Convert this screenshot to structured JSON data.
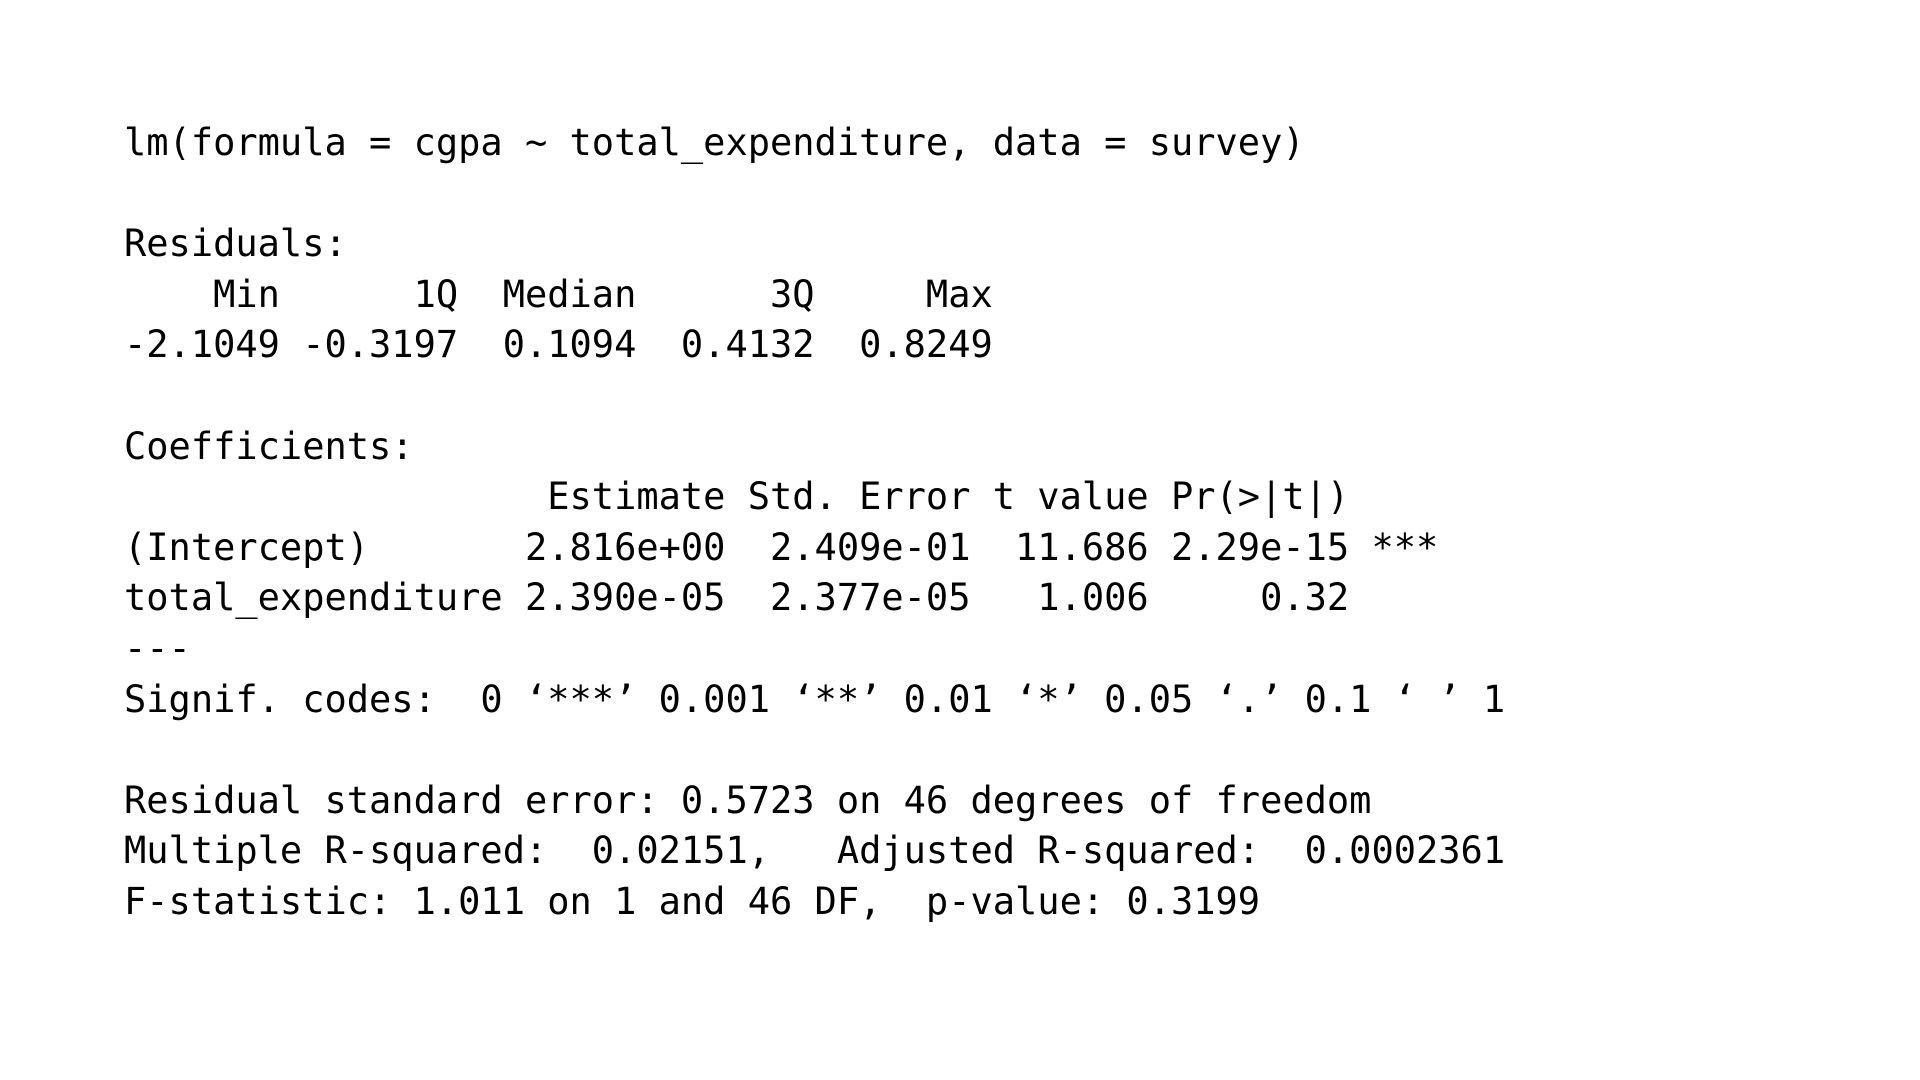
{
  "call": "lm(formula = cgpa ~ total_expenditure, data = survey)",
  "residuals": {
    "heading": "Residuals:",
    "header_line": "    Min      1Q  Median      3Q     Max ",
    "values_line": "-2.1049 -0.3197  0.1094  0.4132  0.8249 "
  },
  "coefficients": {
    "heading": "Coefficients:",
    "header_line": "                   Estimate Std. Error t value Pr(>|t|)    ",
    "rows": [
      "(Intercept)       2.816e+00  2.409e-01  11.686 2.29e-15 ***",
      "total_expenditure 2.390e-05  2.377e-05   1.006     0.32    "
    ],
    "separator": "---",
    "signif_codes": "Signif. codes:  0 ‘***’ 0.001 ‘**’ 0.01 ‘*’ 0.05 ‘.’ 0.1 ‘ ’ 1"
  },
  "summary": {
    "residual_se": "Residual standard error: 0.5723 on 46 degrees of freedom",
    "r_squared": "Multiple R-squared:  0.02151,\tAdjusted R-squared:  0.0002361 ",
    "f_statistic": "F-statistic: 1.011 on 1 and 46 DF,  p-value: 0.3199"
  }
}
